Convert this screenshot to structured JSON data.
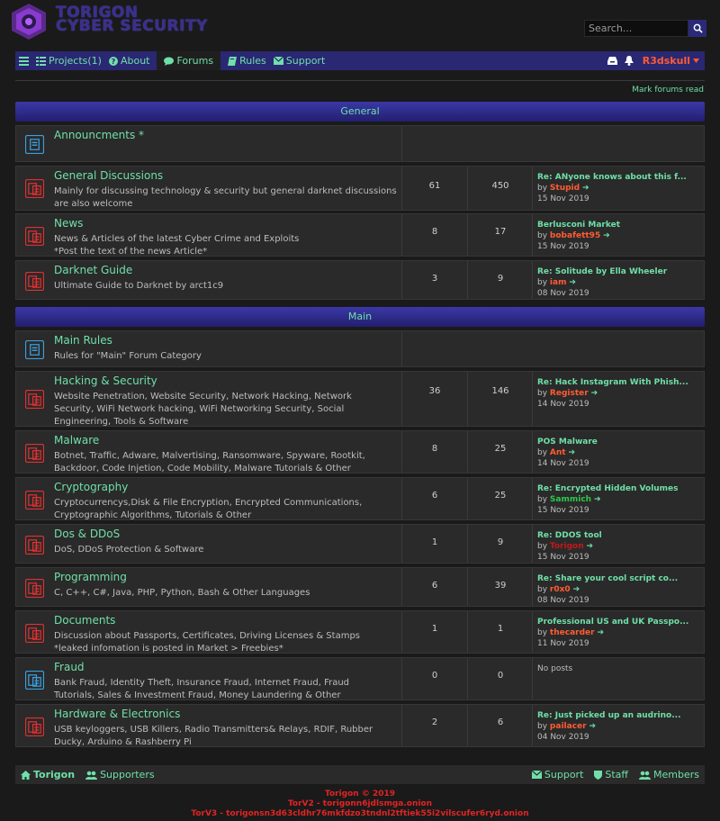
{
  "brand": {
    "line1": "TORIGON",
    "line2": "CYBER SECURITY"
  },
  "search": {
    "placeholder": "Search..."
  },
  "nav": {
    "projects": "Projects(1)",
    "about": "About",
    "forums": "Forums",
    "rules": "Rules",
    "support": "Support",
    "user": "R3dskull"
  },
  "mark_read": "Mark forums read",
  "categories": {
    "general": "General",
    "main": "Main"
  },
  "forums": {
    "announcements": {
      "title": "Announcments *",
      "desc": ""
    },
    "general_discussions": {
      "title": "General Discussions",
      "desc": "Mainly for discussing technology & security but general darknet discussions are also welcome",
      "threads": "61",
      "posts": "450",
      "last_title": "Re: ANyone knows about this f...",
      "last_user": "Stupid",
      "last_date": "15 Nov 2019"
    },
    "news": {
      "title": "News",
      "desc": "News & Articles of the latest Cyber Crime and Exploits *Post the text of the news Article*",
      "threads": "8",
      "posts": "17",
      "last_title": "Berlusconi Market",
      "last_user": "bobafett95",
      "last_date": "15 Nov 2019"
    },
    "darknet_guide": {
      "title": "Darknet Guide",
      "desc": "Ultimate Guide to Darknet by arct1c9",
      "threads": "3",
      "posts": "9",
      "last_title": "Re: Solitude by Ella Wheeler",
      "last_user": "iam",
      "last_date": "08 Nov 2019"
    },
    "main_rules": {
      "title": "Main Rules",
      "desc": "Rules for \"Main\" Forum Category"
    },
    "hacking": {
      "title": "Hacking & Security",
      "desc": "Website Penetration, Website Security, Network Hacking, Network Security, WiFi Network hacking, WiFi Networking Security, Social Engineering, Tools & Software",
      "threads": "36",
      "posts": "146",
      "last_title": "Re: Hack Instagram With Phish...",
      "last_user": "Register",
      "last_date": "14 Nov 2019"
    },
    "malware": {
      "title": "Malware",
      "desc": "Botnet, Traffic, Adware, Malvertising, Ransomware, Spyware, Rootkit, Backdoor, Code Injetion, Code Mobility, Malware Tutorials & Other",
      "threads": "8",
      "posts": "25",
      "last_title": "POS Malware",
      "last_user": "Ant",
      "last_date": "14 Nov 2019"
    },
    "cryptography": {
      "title": "Cryptography",
      "desc": "Cryptocurrencys,Disk & File Encryption, Encrypted Communications, Cryptographic Algorithms, Tutorials & Other",
      "threads": "6",
      "posts": "25",
      "last_title": "Re: Encrypted Hidden Volumes",
      "last_user": "Sammich",
      "last_date": "15 Nov 2019"
    },
    "dos": {
      "title": "Dos & DDoS",
      "desc": "DoS, DDoS Protection & Software",
      "threads": "1",
      "posts": "9",
      "last_title": "Re: DDOS tool",
      "last_user": "Torigon",
      "last_date": "15 Nov 2019"
    },
    "programming": {
      "title": "Programming",
      "desc": "C, C++, C#, Java, PHP, Python, Bash & Other Languages",
      "threads": "6",
      "posts": "39",
      "last_title": "Re: Share your cool script co...",
      "last_user": "r0x0",
      "last_date": "08 Nov 2019"
    },
    "documents": {
      "title": "Documents",
      "desc": "Discussion about Passports, Certificates, Driving Licenses & Stamps *leaked infomation is posted in Market > Freebies*",
      "threads": "1",
      "posts": "1",
      "last_title": "Professional US and UK Passpo...",
      "last_user": "thecarder",
      "last_date": "11 Nov 2019"
    },
    "fraud": {
      "title": "Fraud",
      "desc": "Bank Fraud, Identity Theft, Insurance Fraud, Internet Fraud, Fraud Tutorials, Sales & Investment Fraud, Money Laundering & Other",
      "threads": "0",
      "posts": "0",
      "no_posts": "No posts"
    },
    "hardware": {
      "title": "Hardware & Electronics",
      "desc": "USB keyloggers, USB Killers, Radio Transmitters& Relays, RDIF, Rubber Ducky, Arduino & Rashberry Pi",
      "threads": "2",
      "posts": "6",
      "last_title": "Re: Just picked up an audrino...",
      "last_user": "pailacer",
      "last_date": "04 Nov 2019"
    }
  },
  "by": "by",
  "footer": {
    "torigon": "Torigon",
    "supporters": "Supporters",
    "support": "Support",
    "staff": "Staff",
    "members": "Members",
    "copyright": "Torigon © 2019",
    "torv2": "TorV2 - torigonn6jdlsmga.onion",
    "torv3": "TorV3 - torigonsn3d63cldhr76mkfdzo3tndnl2tftiek55i2vilscufer6ryd.onion"
  },
  "colors": {
    "accent": "#6fe0a8",
    "nav": "#2a2773",
    "user": "#ff5c33",
    "footer_red": "#e22424"
  }
}
